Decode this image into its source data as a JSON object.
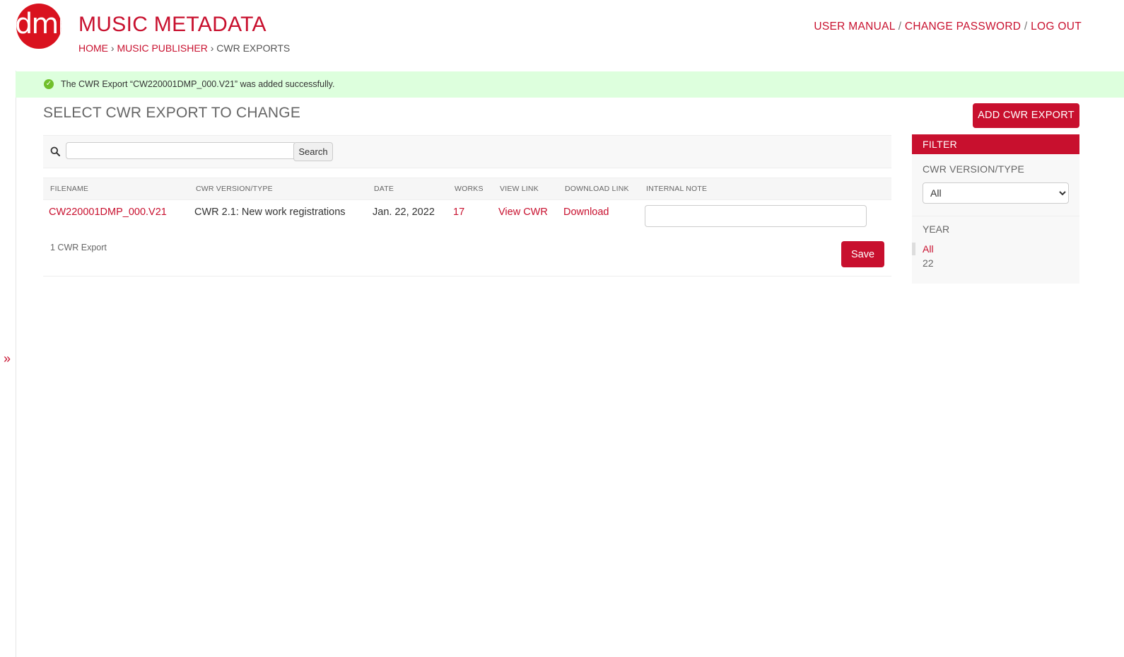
{
  "header": {
    "logo_text": "dmp",
    "site_title": "MUSIC METADATA",
    "breadcrumb": {
      "home": "HOME",
      "sep1": "›",
      "publisher": "MUSIC PUBLISHER",
      "sep2": "›",
      "current": "CWR EXPORTS"
    },
    "user_tools": {
      "manual": "USER MANUAL",
      "sep1": "/",
      "password": "CHANGE PASSWORD",
      "sep2": "/",
      "logout": "LOG OUT"
    }
  },
  "nav_toggle": "»",
  "message": "The CWR Export “CW220001DMP_000.V21” was added successfully.",
  "page_title": "SELECT CWR EXPORT TO CHANGE",
  "add_button": "ADD CWR EXPORT",
  "search": {
    "value": "",
    "button": "Search"
  },
  "table": {
    "headers": [
      "FILENAME",
      "CWR VERSION/TYPE",
      "DATE",
      "WORKS",
      "VIEW LINK",
      "DOWNLOAD LINK",
      "INTERNAL NOTE"
    ],
    "rows": [
      {
        "filename": "CW220001DMP_000.V21",
        "version": "CWR 2.1: New work registrations",
        "date": "Jan. 22, 2022",
        "works": "17",
        "view": "View CWR",
        "download": "Download",
        "note": ""
      }
    ]
  },
  "count_text": "1 CWR Export",
  "save_button": "Save",
  "filter": {
    "title": "FILTER",
    "version_heading": "CWR VERSION/TYPE",
    "version_selected": "All",
    "year_heading": "YEAR",
    "year_options": [
      "All",
      "22"
    ]
  },
  "colors": {
    "accent": "#c8102e",
    "success_bg": "#ddffdd"
  }
}
